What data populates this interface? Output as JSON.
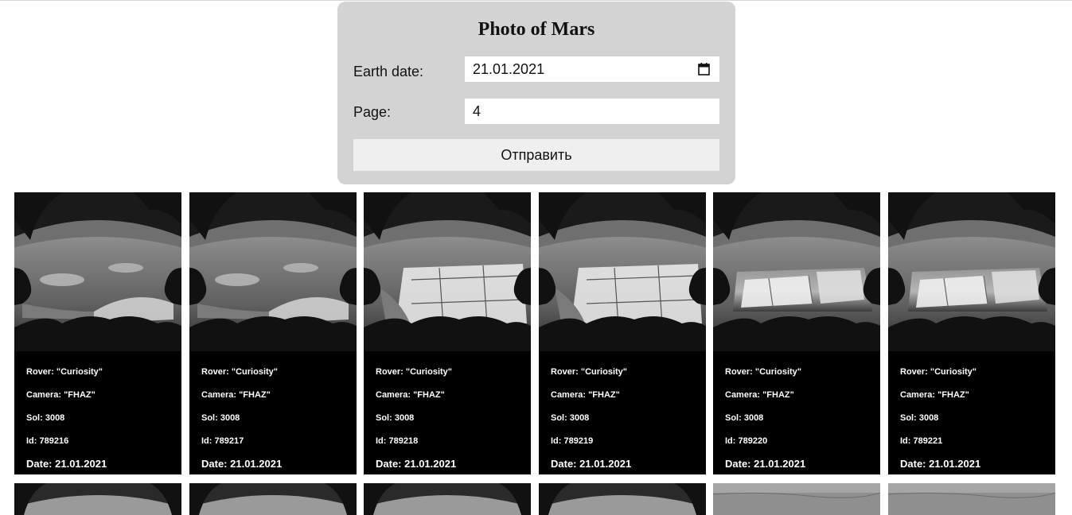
{
  "form": {
    "title": "Photo of Mars",
    "earth_date_label": "Earth date:",
    "earth_date_value": "21.01.2021",
    "page_label": "Page:",
    "page_value": "4",
    "submit_label": "Отправить"
  },
  "photos": [
    {
      "rover": "Rover: \"Curiosity\"",
      "camera": "Camera: \"FHAZ\"",
      "sol": "Sol: 3008",
      "id": "Id: 789216",
      "date": "Date: 21.01.2021",
      "variant": "a"
    },
    {
      "rover": "Rover: \"Curiosity\"",
      "camera": "Camera: \"FHAZ\"",
      "sol": "Sol: 3008",
      "id": "Id: 789217",
      "date": "Date: 21.01.2021",
      "variant": "a"
    },
    {
      "rover": "Rover: \"Curiosity\"",
      "camera": "Camera: \"FHAZ\"",
      "sol": "Sol: 3008",
      "id": "Id: 789218",
      "date": "Date: 21.01.2021",
      "variant": "b"
    },
    {
      "rover": "Rover: \"Curiosity\"",
      "camera": "Camera: \"FHAZ\"",
      "sol": "Sol: 3008",
      "id": "Id: 789219",
      "date": "Date: 21.01.2021",
      "variant": "b"
    },
    {
      "rover": "Rover: \"Curiosity\"",
      "camera": "Camera: \"FHAZ\"",
      "sol": "Sol: 3008",
      "id": "Id: 789220",
      "date": "Date: 21.01.2021",
      "variant": "c"
    },
    {
      "rover": "Rover: \"Curiosity\"",
      "camera": "Camera: \"FHAZ\"",
      "sol": "Sol: 3008",
      "id": "Id: 789221",
      "date": "Date: 21.01.2021",
      "variant": "c"
    }
  ],
  "colors": {
    "panel_bg": "#d3d3d3",
    "card_bg": "#000000",
    "button_bg": "#efefef"
  }
}
